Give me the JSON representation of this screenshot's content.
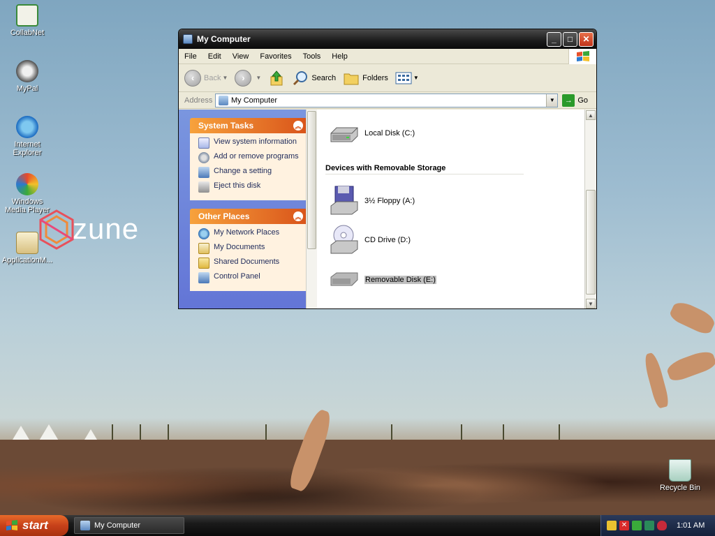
{
  "desktop": {
    "icons": [
      {
        "label": "CollabNet",
        "icon": "collabnet-icon"
      },
      {
        "label": "MyPal",
        "icon": "mypal-icon"
      },
      {
        "label": "Internet Explorer",
        "icon": "internet-explorer-icon"
      },
      {
        "label": "Windows Media Player",
        "icon": "windows-media-player-icon"
      },
      {
        "label": "ApplicationM...",
        "icon": "application-icon"
      },
      {
        "label": "Recycle Bin",
        "icon": "recycle-bin-icon"
      }
    ],
    "zune_logo": "zune"
  },
  "window": {
    "title": "My Computer",
    "menu": [
      "File",
      "Edit",
      "View",
      "Favorites",
      "Tools",
      "Help"
    ],
    "toolbar": {
      "back": "Back",
      "search": "Search",
      "folders": "Folders"
    },
    "address": {
      "label": "Address",
      "value": "My Computer",
      "go": "Go"
    },
    "system_tasks": {
      "title": "System Tasks",
      "items": [
        "View system information",
        "Add or remove programs",
        "Change a setting",
        "Eject this disk"
      ]
    },
    "other_places": {
      "title": "Other Places",
      "items": [
        "My Network Places",
        "My Documents",
        "Shared Documents",
        "Control Panel"
      ]
    },
    "drives": {
      "local": "Local Disk (C:)",
      "removable_group": "Devices with Removable Storage",
      "floppy": "3½ Floppy (A:)",
      "cd": "CD Drive (D:)",
      "removable": "Removable Disk (E:)"
    }
  },
  "taskbar": {
    "start": "start",
    "task": "My Computer",
    "clock": "1:01 AM"
  },
  "colors": {
    "task_pane_header": "#d9541a",
    "task_pane_bg": "#fff2e0",
    "left_pane_bg": "#6375d6",
    "start_button": "#c7411a"
  }
}
